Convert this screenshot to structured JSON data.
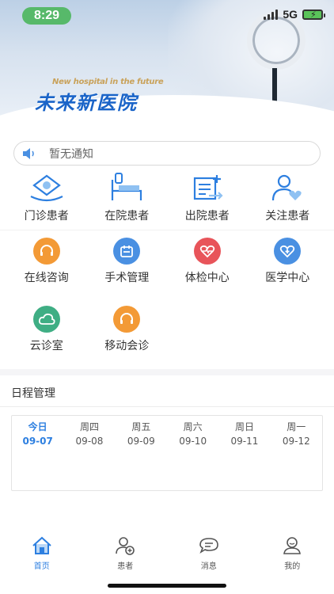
{
  "status_bar": {
    "time": "8:29",
    "network": "5G"
  },
  "banner": {
    "subtitle": "New hospital in the future",
    "title": "未来新医院"
  },
  "notice": {
    "icon": "speaker-icon",
    "text": "暂无通知"
  },
  "patients": [
    {
      "label": "门诊患者",
      "icon": "outpatient-icon"
    },
    {
      "label": "在院患者",
      "icon": "inpatient-bed-icon"
    },
    {
      "label": "出院患者",
      "icon": "discharge-icon"
    },
    {
      "label": "关注患者",
      "icon": "followed-patient-icon"
    }
  ],
  "services": [
    {
      "label": "在线咨询",
      "icon": "headset-icon",
      "color": "#f39a36"
    },
    {
      "label": "手术管理",
      "icon": "calendar-icon",
      "color": "#4a90e2"
    },
    {
      "label": "体检中心",
      "icon": "heart-pulse-icon",
      "color": "#e8545a"
    },
    {
      "label": "医学中心",
      "icon": "medical-cross-icon",
      "color": "#4a90e2"
    },
    {
      "label": "云诊室",
      "icon": "cloud-clinic-icon",
      "color": "#3fae84"
    },
    {
      "label": "移动会诊",
      "icon": "headset-icon",
      "color": "#f39a36"
    }
  ],
  "schedule": {
    "title": "日程管理",
    "days": [
      {
        "weekday": "今日",
        "date": "09-07",
        "today": true
      },
      {
        "weekday": "周四",
        "date": "09-08",
        "today": false
      },
      {
        "weekday": "周五",
        "date": "09-09",
        "today": false
      },
      {
        "weekday": "周六",
        "date": "09-10",
        "today": false
      },
      {
        "weekday": "周日",
        "date": "09-11",
        "today": false
      },
      {
        "weekday": "周一",
        "date": "09-12",
        "today": false
      }
    ]
  },
  "tabbar": [
    {
      "label": "首页",
      "icon": "home-icon",
      "active": true
    },
    {
      "label": "患者",
      "icon": "patient-add-icon",
      "active": false
    },
    {
      "label": "消息",
      "icon": "message-icon",
      "active": false
    },
    {
      "label": "我的",
      "icon": "profile-icon",
      "active": false
    }
  ],
  "colors": {
    "accent": "#2d7fe0",
    "status_green": "#57b96a"
  }
}
